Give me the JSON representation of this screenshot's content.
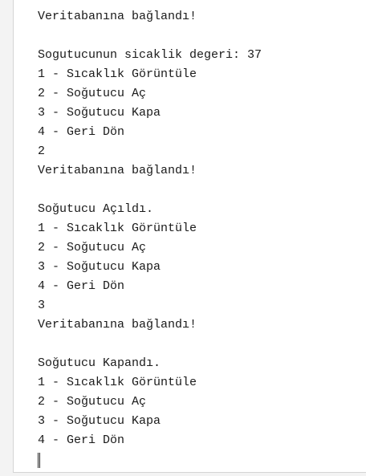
{
  "console": {
    "lines": [
      "Veritabanına bağlandı!",
      "",
      "Sogutucunun sicaklik degeri: 37",
      "1 - Sıcaklık Görüntüle",
      "2 - Soğutucu Aç",
      "3 - Soğutucu Kapa",
      "4 - Geri Dön",
      "2",
      "Veritabanına bağlandı!",
      "",
      "Soğutucu Açıldı.",
      "1 - Sıcaklık Görüntüle",
      "2 - Soğutucu Aç",
      "3 - Soğutucu Kapa",
      "4 - Geri Dön",
      "3",
      "Veritabanına bağlandı!",
      "",
      "Soğutucu Kapandı.",
      "1 - Sıcaklık Görüntüle",
      "2 - Soğutucu Aç",
      "3 - Soğutucu Kapa",
      "4 - Geri Dön"
    ]
  }
}
